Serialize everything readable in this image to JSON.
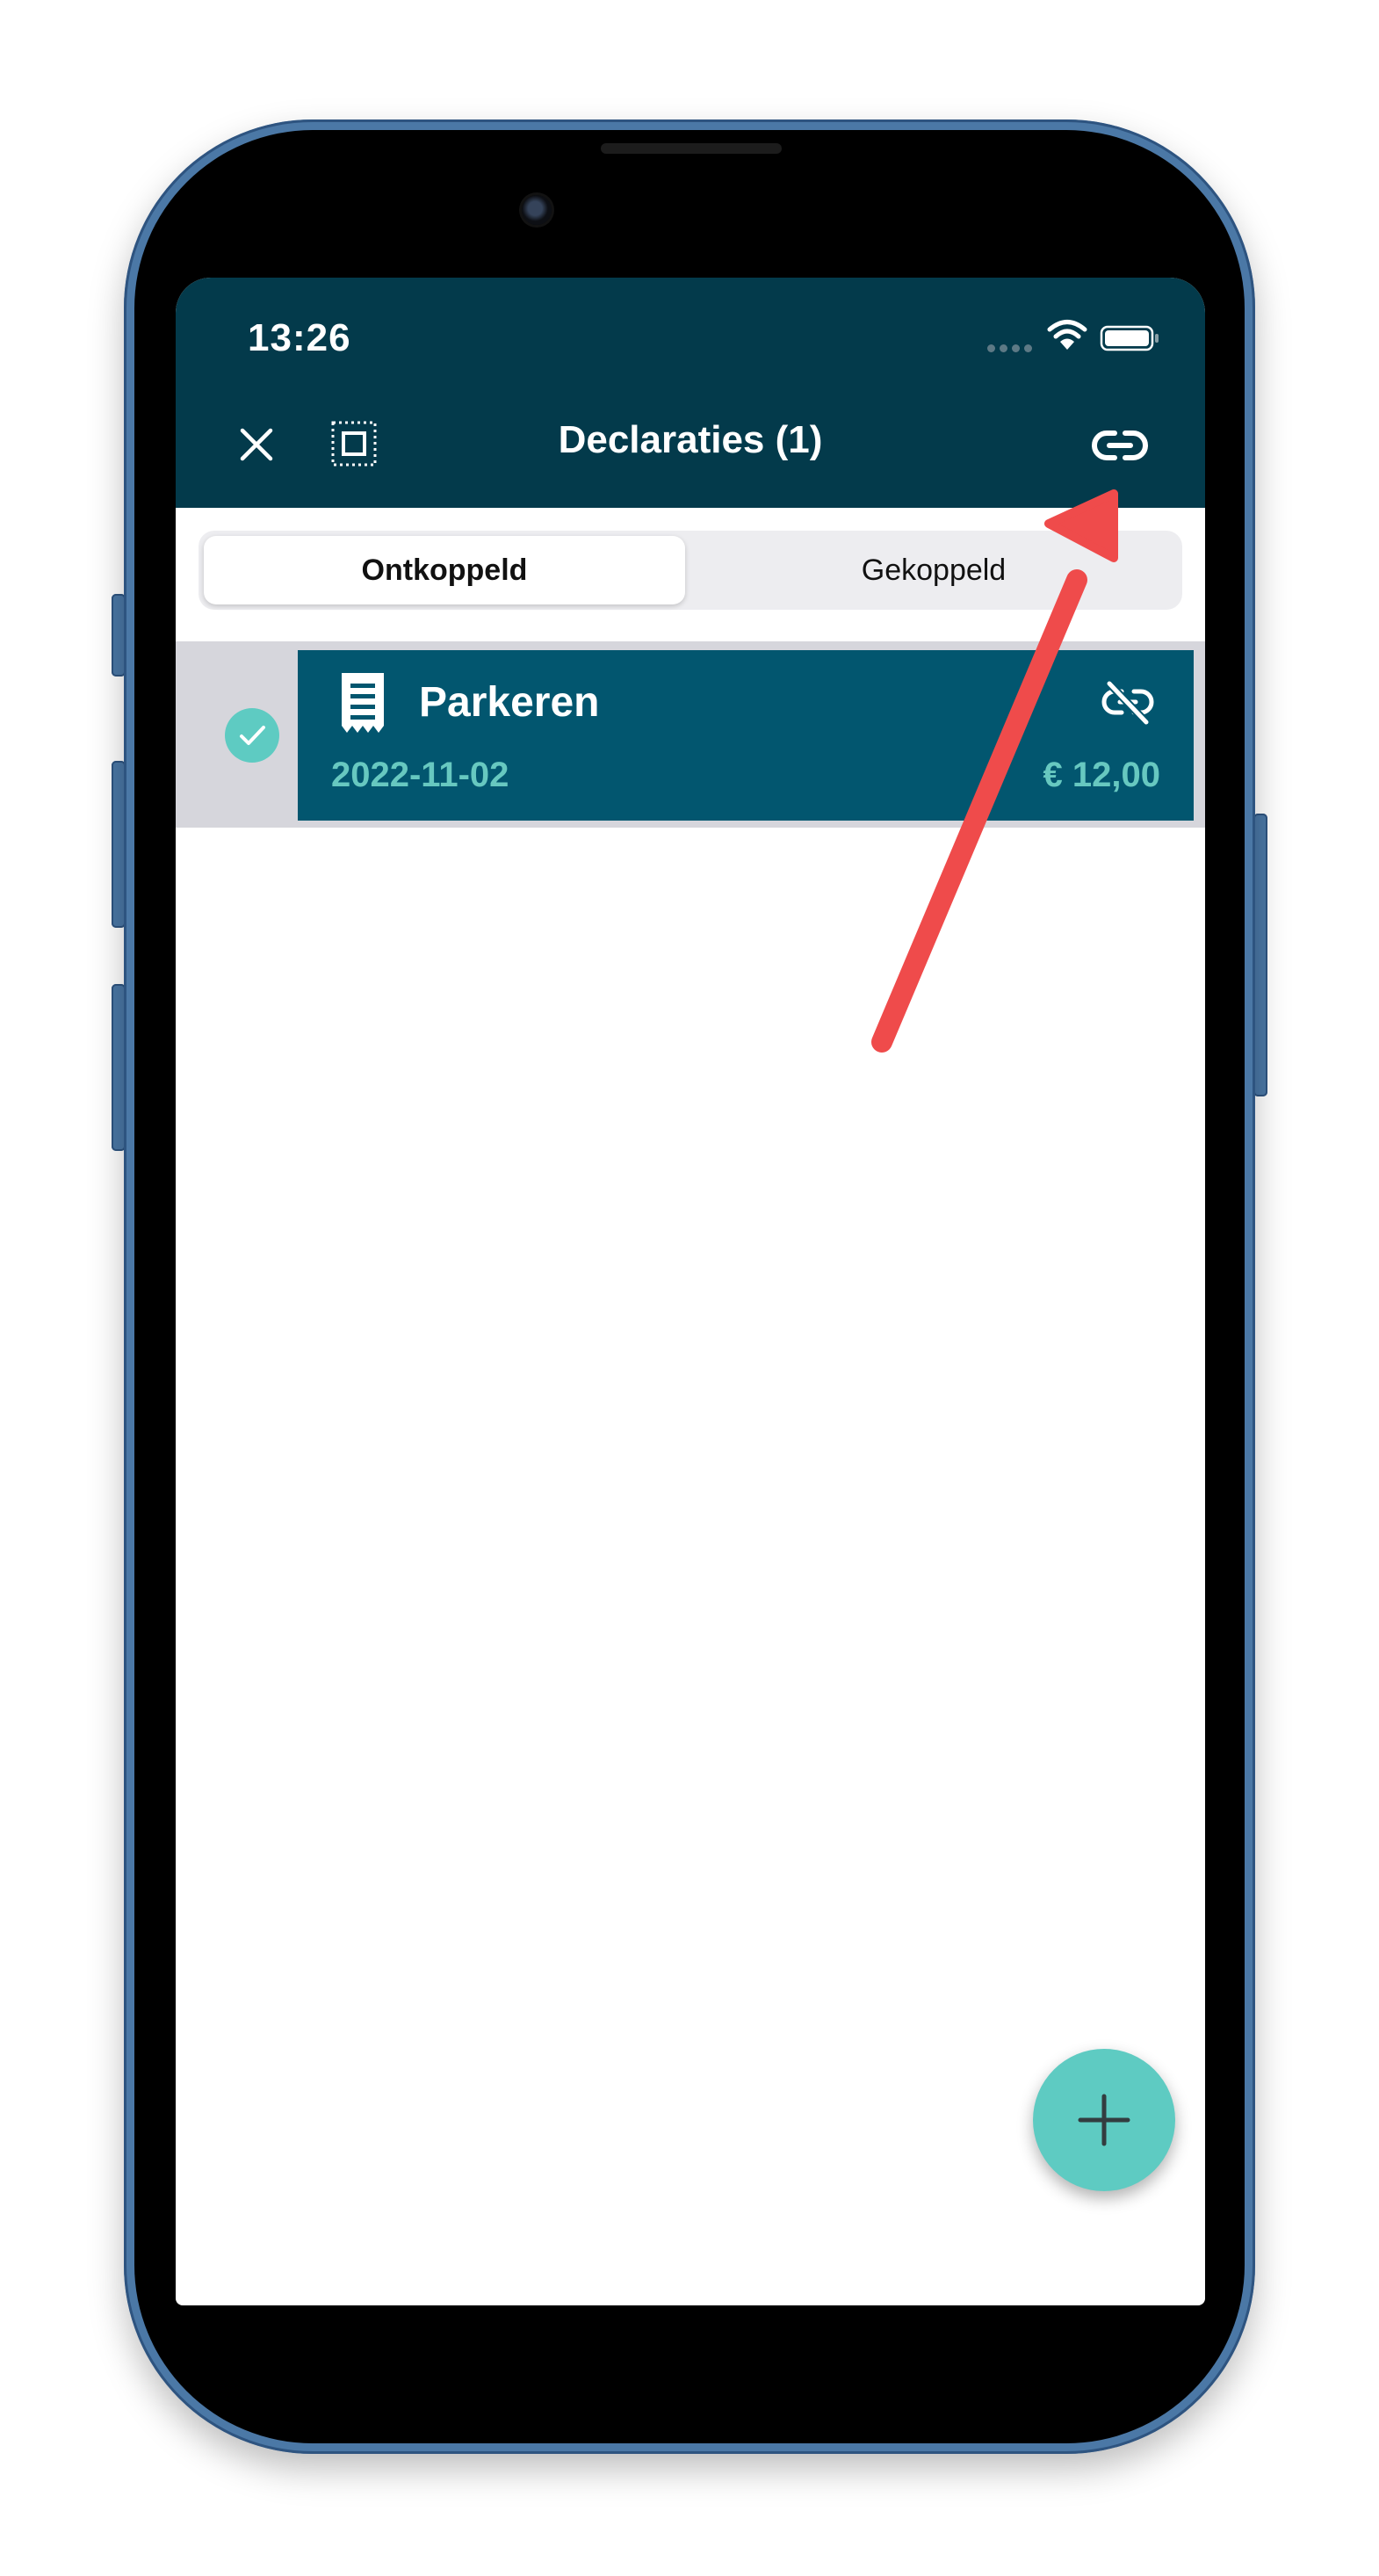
{
  "status_bar": {
    "time": "13:26",
    "icons": [
      "signal-dots-icon",
      "wifi-icon",
      "battery-icon"
    ]
  },
  "nav_bar": {
    "title": "Declaraties (1)",
    "left_icons": [
      "close-icon",
      "select-all-icon"
    ],
    "right_icon": "link-icon"
  },
  "segmented_control": {
    "tabs": [
      {
        "label": "Ontkoppeld",
        "active": true
      },
      {
        "label": "Gekoppeld",
        "active": false
      }
    ]
  },
  "list": {
    "items": [
      {
        "title": "Parkeren",
        "date": "2022-11-02",
        "amount": "€ 12,00",
        "selected": true,
        "icon": "receipt-icon",
        "status_icon": "unlink-icon"
      }
    ]
  },
  "fab": {
    "icon": "plus-icon"
  },
  "annotation": {
    "icon": "red-arrow-pointing-to-link-icon"
  },
  "colors": {
    "header": "#033a4b",
    "card": "#02566f",
    "accent_teal": "#5ecbc2",
    "row_selected_bg": "#d6d6dc",
    "arrow": "#ef4b4b",
    "phone_frame": "#4b78a6"
  }
}
